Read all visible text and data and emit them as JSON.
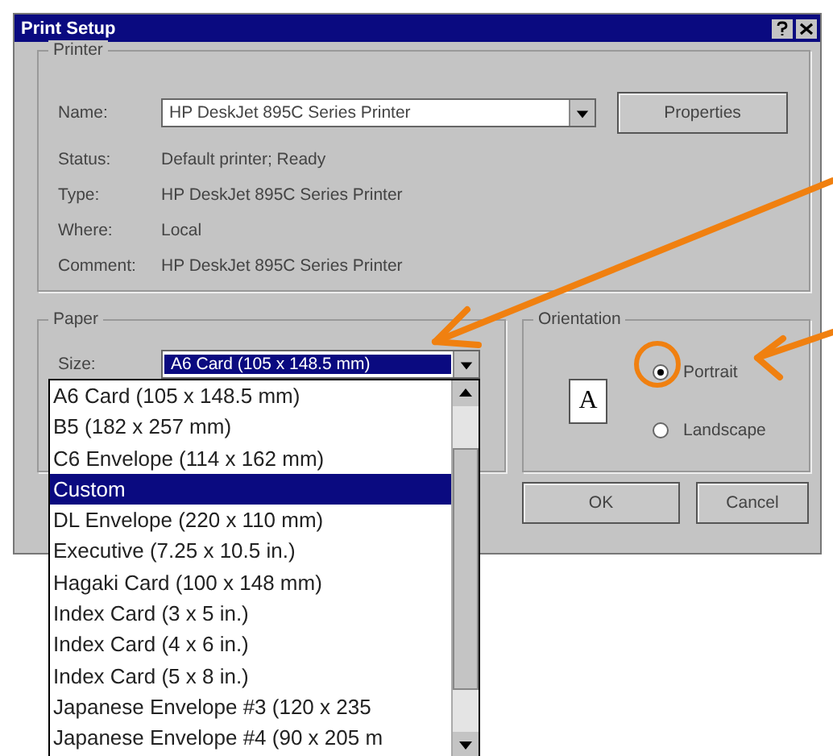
{
  "window": {
    "title": "Print Setup"
  },
  "printer": {
    "group_label": "Printer",
    "name_label": "Name:",
    "name_value": "HP DeskJet 895C Series Printer",
    "properties_button": "Properties",
    "details": [
      {
        "label": "Status:",
        "value": "Default printer; Ready"
      },
      {
        "label": "Type:",
        "value": "HP DeskJet 895C Series Printer"
      },
      {
        "label": "Where:",
        "value": "Local"
      },
      {
        "label": "Comment:",
        "value": "HP DeskJet 895C Series Printer"
      }
    ]
  },
  "paper": {
    "group_label": "Paper",
    "size_label": "Size:",
    "size_value": "A6 Card (105 x 148.5 mm)",
    "size_options": [
      {
        "label": "A6 Card (105 x 148.5 mm)",
        "selected": false
      },
      {
        "label": "B5 (182 x 257 mm)",
        "selected": false
      },
      {
        "label": "C6 Envelope (114 x 162 mm)",
        "selected": false
      },
      {
        "label": "Custom",
        "selected": true
      },
      {
        "label": "DL Envelope (220 x 110 mm)",
        "selected": false
      },
      {
        "label": "Executive (7.25 x 10.5 in.)",
        "selected": false
      },
      {
        "label": "Hagaki Card (100 x 148 mm)",
        "selected": false
      },
      {
        "label": "Index Card (3 x 5 in.)",
        "selected": false
      },
      {
        "label": "Index Card (4 x 6 in.)",
        "selected": false
      },
      {
        "label": "Index Card (5 x 8 in.)",
        "selected": false
      },
      {
        "label": "Japanese Envelope #3 (120 x 235",
        "selected": false
      },
      {
        "label": "Japanese Envelope #4 (90 x 205 m",
        "selected": false
      }
    ]
  },
  "orientation": {
    "group_label": "Orientation",
    "icon_letter": "A",
    "options": [
      {
        "label": "Portrait",
        "selected": true
      },
      {
        "label": "Landscape",
        "selected": false
      }
    ]
  },
  "buttons": [
    "OK",
    "Cancel"
  ]
}
